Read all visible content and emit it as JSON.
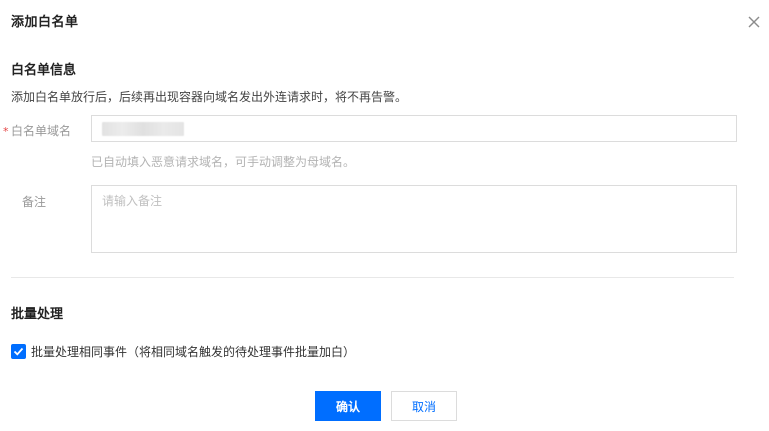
{
  "dialog": {
    "title": "添加白名单",
    "close_icon": "close-icon"
  },
  "info_section": {
    "title": "白名单信息",
    "description": "添加白名单放行后，后续再出现容器向域名发出外连请求时，将不再告警。",
    "domain_field": {
      "required_mark": "*",
      "label": "白名单域名",
      "value": "xxxxxxxx",
      "hint": "已自动填入恶意请求域名，可手动调整为母域名。"
    },
    "note_field": {
      "label": "备注",
      "placeholder": "请输入备注"
    }
  },
  "batch_section": {
    "title": "批量处理",
    "checkbox": {
      "checked": true,
      "label": "批量处理相同事件（将相同域名触发的待处理事件批量加白）"
    }
  },
  "footer": {
    "confirm_label": "确认",
    "cancel_label": "取消"
  },
  "colors": {
    "primary": "#006eff",
    "required": "#e54545",
    "border": "#dcdcdc"
  }
}
